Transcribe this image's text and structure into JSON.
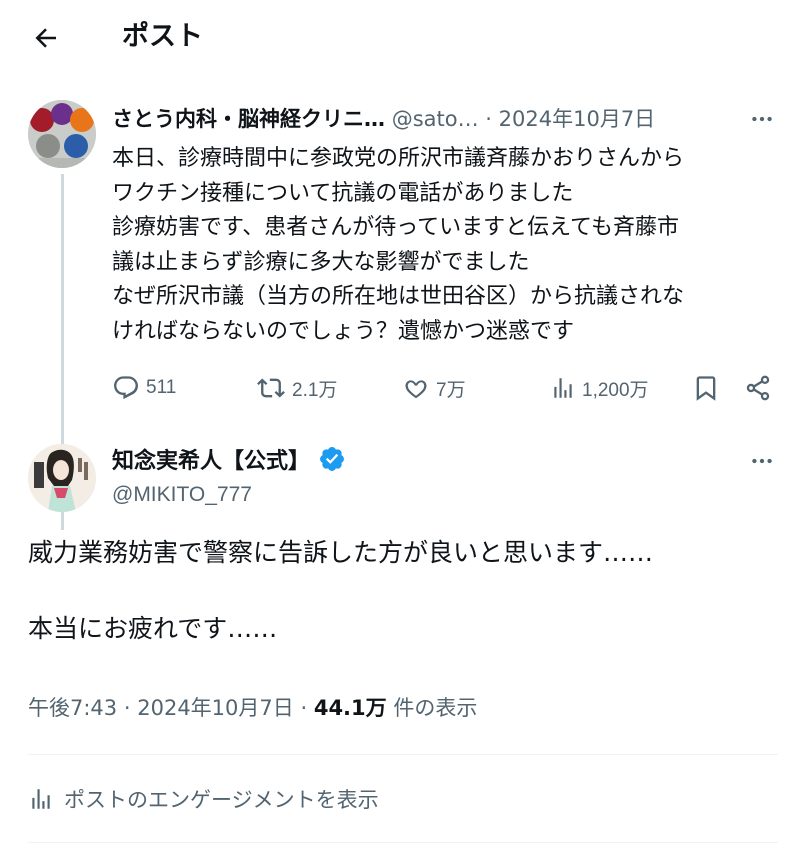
{
  "header": {
    "title": "ポスト",
    "back_icon": "arrow-left-icon"
  },
  "parent_post": {
    "author_name": "さとう内科・脳神経クリニ…",
    "handle": "@sato…",
    "separator": "·",
    "date": "2024年10月7日",
    "body": "本日、診療時間中に参政党の所沢市議斉藤かおりさんから\nワクチン接種について抗議の電話がありました\n診療妨害です、患者さんが待っていますと伝えても斉藤市\n議は止まらず診療に多大な影響がでました\nなぜ所沢市議（当方の所在地は世田谷区）から抗議されな\nければならないのでしょう？遺憾かつ迷惑です",
    "stats": {
      "replies": "511",
      "reposts": "2.1万",
      "likes": "7万",
      "views": "1,200万"
    }
  },
  "main_post": {
    "author_name": "知念実希人【公式】",
    "handle": "@MIKITO_777",
    "body": "威力業務妨害で警察に告訴した方が良いと思います……\n\n本当にお疲れです……",
    "time": "午後7:43",
    "date": "2024年10月7日",
    "separator": "·",
    "views_count": "44.1万",
    "views_label": "件の表示",
    "engagements_label": "ポストのエンゲージメントを表示"
  },
  "colors": {
    "text": "#0f1419",
    "secondary": "#536471",
    "verified": "#1d9bf0",
    "line": "#cfd9de"
  }
}
